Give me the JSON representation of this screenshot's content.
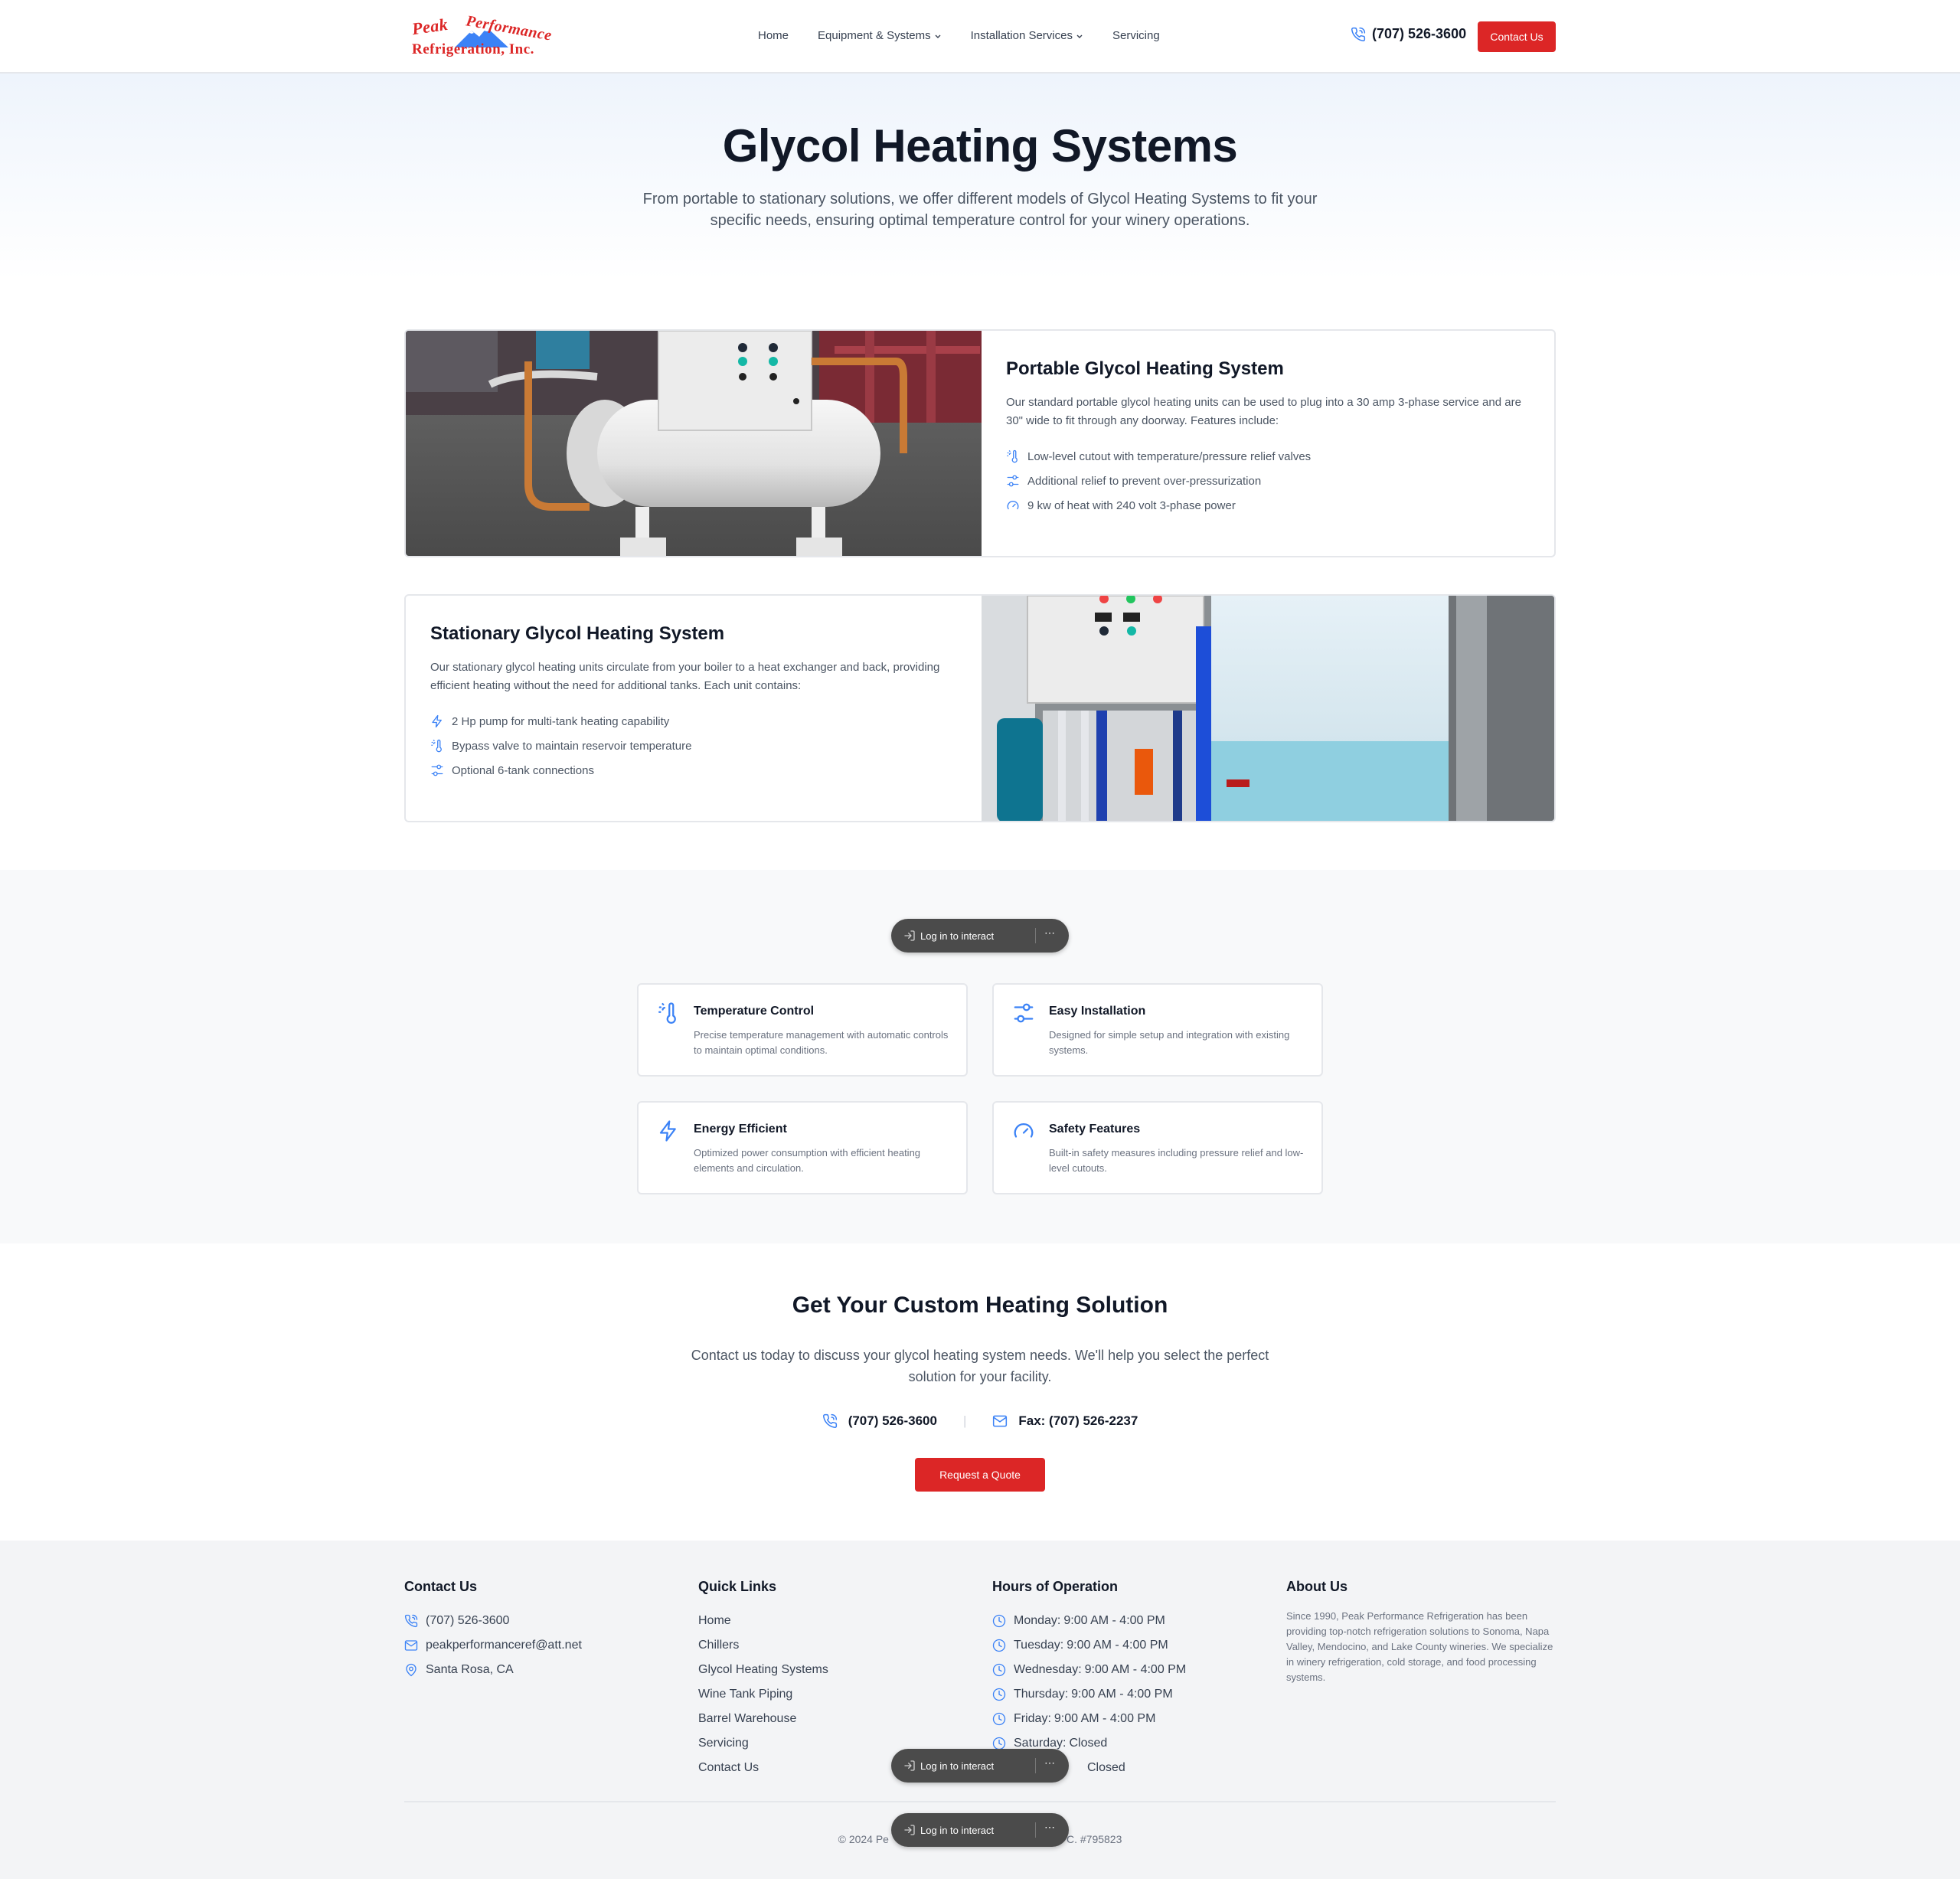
{
  "header": {
    "logo": {
      "line1": "Peak",
      "line1b": "Performance",
      "line2": "Refrigeration, Inc."
    },
    "nav": [
      {
        "label": "Home",
        "dropdown": false
      },
      {
        "label": "Equipment & Systems",
        "dropdown": true
      },
      {
        "label": "Installation Services",
        "dropdown": true
      },
      {
        "label": "Servicing",
        "dropdown": false
      }
    ],
    "phone": "(707) 526-3600",
    "contact_button": "Contact Us"
  },
  "hero": {
    "title": "Glycol Heating Systems",
    "subtitle": "From portable to stationary solutions, we offer different models of Glycol Heating Systems to fit your specific needs, ensuring optimal temperature control for your winery operations."
  },
  "products": [
    {
      "title": "Portable Glycol Heating System",
      "description": "Our standard portable glycol heating units can be used to plug into a 30 amp 3-phase service and are 30\" wide to fit through any doorway. Features include:",
      "features": [
        {
          "icon": "thermometer-sun-icon",
          "text": "Low-level cutout with temperature/pressure relief valves"
        },
        {
          "icon": "settings-sliders-icon",
          "text": "Additional relief to prevent over-pressurization"
        },
        {
          "icon": "gauge-icon",
          "text": "9 kw of heat with 240 volt 3-phase power"
        }
      ]
    },
    {
      "title": "Stationary Glycol Heating System",
      "description": "Our stationary glycol heating units circulate from your boiler to a heat exchanger and back, providing efficient heating without the need for additional tanks. Each unit contains:",
      "features": [
        {
          "icon": "lightning-icon",
          "text": "2 Hp pump for multi-tank heating capability"
        },
        {
          "icon": "thermometer-sun-icon",
          "text": "Bypass valve to maintain reservoir temperature"
        },
        {
          "icon": "settings-sliders-icon",
          "text": "Optional 6-tank connections"
        }
      ]
    }
  ],
  "features_section": {
    "heading": "",
    "cards": [
      {
        "icon": "thermometer-sun-icon",
        "title": "Temperature Control",
        "text": "Precise temperature management with automatic controls to maintain optimal conditions."
      },
      {
        "icon": "settings-sliders-icon",
        "title": "Easy Installation",
        "text": "Designed for simple setup and integration with existing systems."
      },
      {
        "icon": "lightning-icon",
        "title": "Energy Efficient",
        "text": "Optimized power consumption with efficient heating elements and circulation."
      },
      {
        "icon": "gauge-icon",
        "title": "Safety Features",
        "text": "Built-in safety measures including pressure relief and low-level cutouts."
      }
    ]
  },
  "overlay": {
    "label": "Log in to interact",
    "more": "⋯"
  },
  "cta": {
    "title": "Get Your Custom Heating Solution",
    "text": "Contact us today to discuss your glycol heating system needs. We'll help you select the perfect solution for your facility.",
    "phone": "(707) 526-3600",
    "divider": "|",
    "fax": "Fax: (707) 526-2237",
    "button": "Request a Quote"
  },
  "footer": {
    "contact": {
      "title": "Contact Us",
      "phone": "(707) 526-3600",
      "email": "peakperformanceref@att.net",
      "location": "Santa Rosa, CA"
    },
    "quick_links": {
      "title": "Quick Links",
      "items": [
        "Home",
        "Chillers",
        "Glycol Heating Systems",
        "Wine Tank Piping",
        "Barrel Warehouse",
        "Servicing",
        "Contact Us"
      ]
    },
    "hours": {
      "title": "Hours of Operation",
      "items": [
        {
          "day": "Monday:",
          "time": "9:00 AM - 4:00 PM"
        },
        {
          "day": "Tuesday:",
          "time": "9:00 AM - 4:00 PM"
        },
        {
          "day": "Wednesday:",
          "time": "9:00 AM - 4:00 PM"
        },
        {
          "day": "Thursday:",
          "time": "9:00 AM - 4:00 PM"
        },
        {
          "day": "Friday:",
          "time": "9:00 AM - 4:00 PM"
        },
        {
          "day": "Saturday:",
          "time": "Closed"
        },
        {
          "day": "",
          "time": "Closed"
        }
      ]
    },
    "about": {
      "title": "About Us",
      "text": "Since 1990, Peak Performance Refrigeration has been providing top-notch refrigeration solutions to Sonoma, Napa Valley, Mendocino, and Lake County wineries. We specialize in winery refrigeration, cold storage, and food processing systems."
    },
    "copyright_left": "© 2024 Pe",
    "copyright_right": "C. #795823"
  },
  "colors": {
    "accent_red": "#dc2626",
    "icon_blue": "#3b82f6",
    "text_dark": "#111827",
    "text_muted": "#4b5563"
  }
}
